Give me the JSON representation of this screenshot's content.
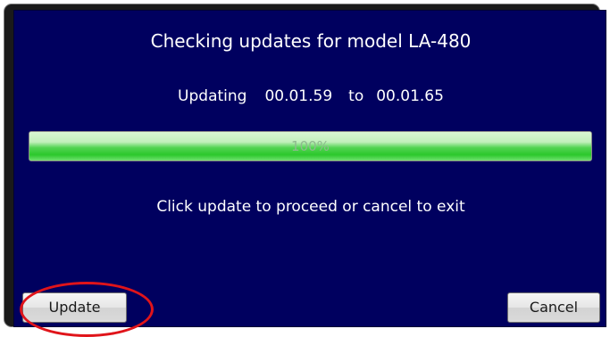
{
  "dialog": {
    "title": "Checking updates for model LA-480",
    "version_line": {
      "label": "Updating",
      "from_version": "00.01.59",
      "connector": "to",
      "to_version": "00.01.65"
    },
    "progress": {
      "value_percent": 100,
      "label": "100%"
    },
    "message": "Click update to proceed or cancel to exit",
    "buttons": {
      "update_label": "Update",
      "cancel_label": "Cancel"
    },
    "colors": {
      "panel_background": "#00005f",
      "text": "#ffffff",
      "progress_fill": "#2cc82c",
      "annotation_ring": "#e0141a"
    }
  }
}
